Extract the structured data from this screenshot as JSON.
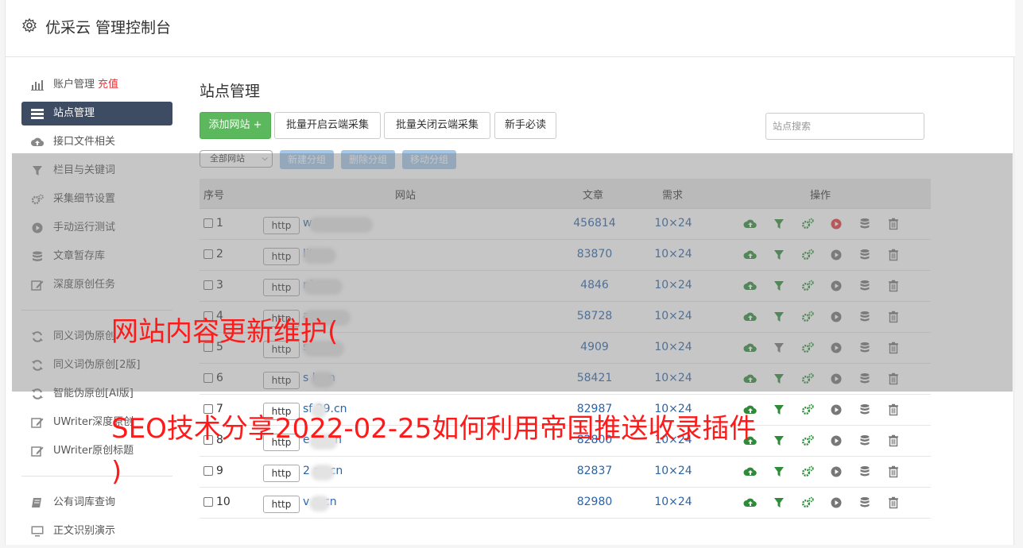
{
  "header": {
    "title": "优采云 管理控制台",
    "icon": "gear-icon"
  },
  "sidebar": {
    "items": [
      {
        "label": "账户管理",
        "extra": "充值",
        "icon": "bar-chart-icon"
      },
      {
        "label": "站点管理",
        "icon": "server-icon",
        "active": true
      },
      {
        "label": "接口文件相关",
        "icon": "cloud-upload-icon"
      },
      {
        "label": "栏目与关键词",
        "icon": "filter-icon"
      },
      {
        "label": "采集细节设置",
        "icon": "cogs-icon"
      },
      {
        "label": "手动运行测试",
        "icon": "play-circle-icon"
      },
      {
        "label": "文章暂存库",
        "icon": "database-icon"
      },
      {
        "label": "深度原创任务",
        "icon": "edit-icon"
      },
      {
        "label": "同义词伪原创",
        "icon": "refresh-icon"
      },
      {
        "label": "同义词伪原创[2版]",
        "icon": "refresh-icon"
      },
      {
        "label": "智能伪原创[AI版]",
        "icon": "refresh-icon"
      },
      {
        "label": "UWriter深度原创",
        "icon": "edit-icon"
      },
      {
        "label": "UWriter原创标题",
        "icon": "edit-icon"
      },
      {
        "label": "公有词库查询",
        "icon": "book-icon"
      },
      {
        "label": "正文识别演示",
        "icon": "monitor-icon"
      }
    ]
  },
  "main": {
    "title": "站点管理",
    "toolbar": {
      "add_site": "添加网站 +",
      "batch_open": "批量开启云端采集",
      "batch_close": "批量关闭云端采集",
      "newbie": "新手必读",
      "search_placeholder": "站点搜索"
    },
    "subbar": {
      "group_select": "全部网站",
      "new_group": "新建分组",
      "delete_group": "删除分组",
      "move_group": "移动分组"
    },
    "table": {
      "headers": {
        "no": "序号",
        "site": "网站",
        "articles": "文章",
        "demand": "需求",
        "ops": "操作"
      },
      "rows": [
        {
          "no": "1",
          "http": "http",
          "site": "w            .com",
          "articles": "456814",
          "demand": "10×24",
          "active_play": true
        },
        {
          "no": "2",
          "http": "http",
          "site": "        lit.cn",
          "articles": "83870",
          "demand": "10×24"
        },
        {
          "no": "3",
          "http": "http",
          "site": "        ni.cn",
          "articles": "4846",
          "demand": "10×24"
        },
        {
          "no": "4",
          "http": "http",
          "site": "        ay.cn",
          "articles": "58728",
          "demand": "10×24"
        },
        {
          "no": "5",
          "http": "http",
          "site": "        s.cn",
          "articles": "4909",
          "demand": "10×24"
        },
        {
          "no": "6",
          "http": "http",
          "site": "s     k.cn",
          "articles": "58421",
          "demand": "10×24"
        },
        {
          "no": "7",
          "http": "http",
          "site": "sf  29.cn",
          "articles": "82987",
          "demand": "10×24"
        },
        {
          "no": "8",
          "http": "http",
          "site": "e     ey.cn",
          "articles": "82800",
          "demand": "10×24"
        },
        {
          "no": "9",
          "http": "http",
          "site": "2     az.cn",
          "articles": "82837",
          "demand": "10×24"
        },
        {
          "no": "10",
          "http": "http",
          "site": "v     p.cn",
          "articles": "82980",
          "demand": "10×24"
        }
      ]
    }
  },
  "watermark": {
    "line1": "网站内容更新维护(",
    "line2": "SEO技术分享2022-02-25如何利用帝国推送收录插件",
    "line3": ")"
  },
  "colors": {
    "green": "#5cb85c",
    "active_sidebar": "#3d4b63",
    "link": "#2a63a8",
    "watermark": "#ff1a1a",
    "play_active": "#e4393c"
  }
}
